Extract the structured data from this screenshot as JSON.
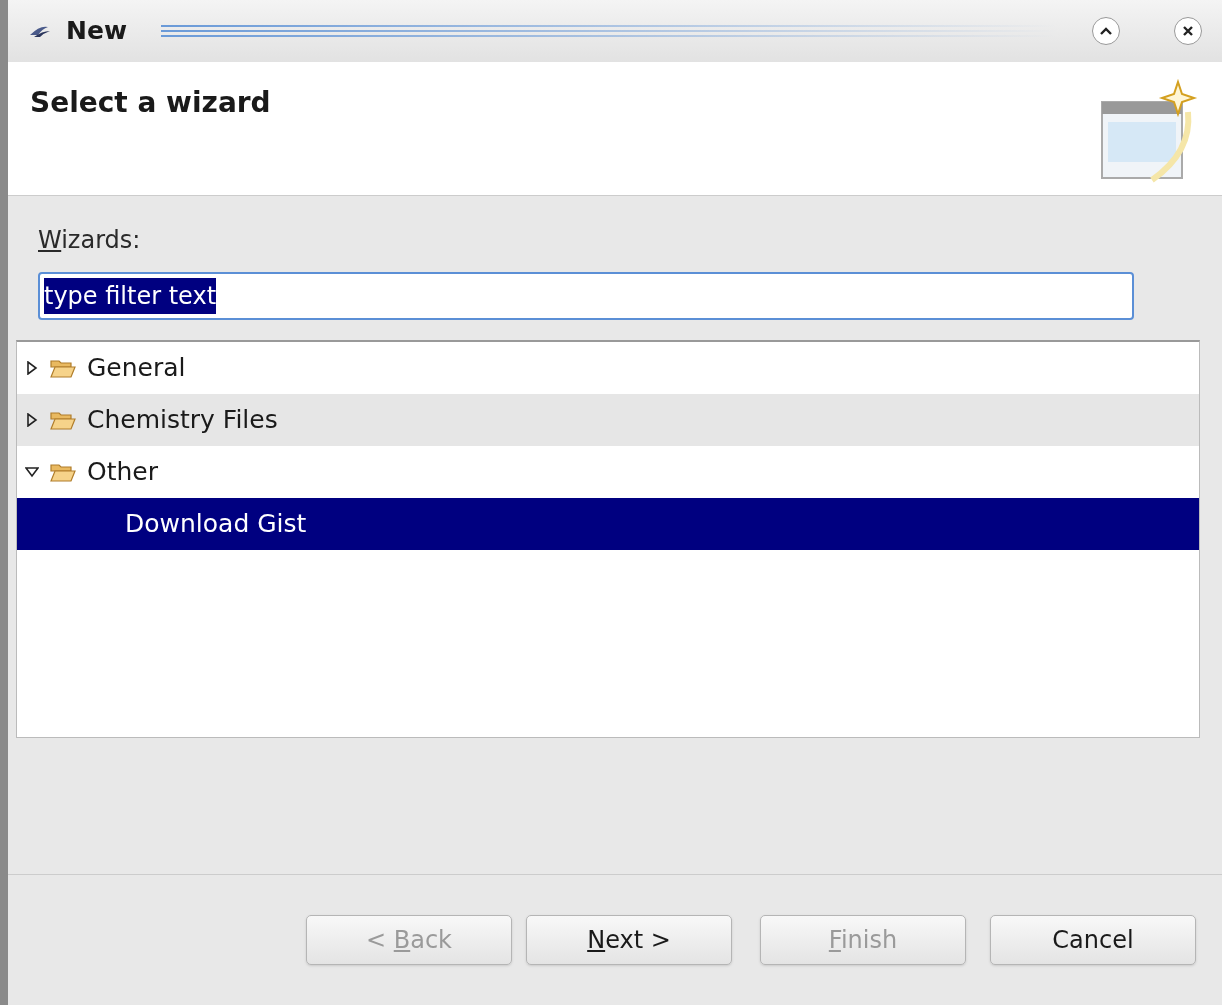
{
  "window": {
    "title": "New"
  },
  "header": {
    "title": "Select a wizard"
  },
  "filter": {
    "label": {
      "mnemonic": "W",
      "rest": "izards:"
    },
    "value": "type filter text",
    "text_selected": true
  },
  "tree": [
    {
      "kind": "folder",
      "label": "General",
      "expanded": false,
      "highlighted": false,
      "selected": false
    },
    {
      "kind": "folder",
      "label": "Chemistry Files",
      "expanded": false,
      "highlighted": true,
      "selected": false
    },
    {
      "kind": "folder",
      "label": "Other",
      "expanded": true,
      "highlighted": false,
      "selected": false,
      "children": [
        {
          "kind": "item",
          "label": "Download Gist",
          "selected": true
        }
      ]
    }
  ],
  "buttons": [
    {
      "prefix": "< ",
      "mnemonic": "B",
      "rest": "ack",
      "disabled": true
    },
    {
      "mnemonic": "N",
      "rest": "ext >",
      "disabled": false
    },
    {
      "mnemonic": "F",
      "rest": "inish",
      "disabled": true
    },
    {
      "rest": "Cancel",
      "disabled": false
    }
  ]
}
